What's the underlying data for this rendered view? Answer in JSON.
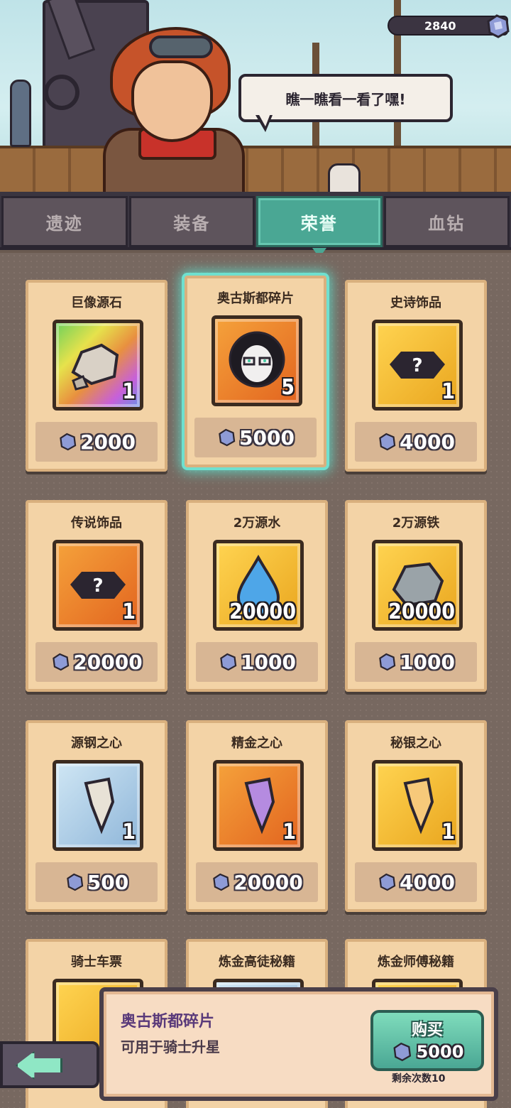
{
  "header": {
    "currency_value": "2840",
    "speech_text": "瞧一瞧看一看了嘿!"
  },
  "tabs": [
    {
      "label": "遗迹",
      "active": false
    },
    {
      "label": "装备",
      "active": false
    },
    {
      "label": "荣誉",
      "active": true
    },
    {
      "label": "血钻",
      "active": false
    }
  ],
  "items": [
    {
      "name": "巨像源石",
      "qty": "1",
      "price": "2000",
      "bg": "rainbow",
      "icon": "rock-icon"
    },
    {
      "name": "奥古斯都碎片",
      "qty": "5",
      "price": "5000",
      "bg": "orange",
      "icon": "hero-portrait-icon",
      "selected": true
    },
    {
      "name": "史诗饰品",
      "qty": "1",
      "price": "4000",
      "bg": "gold",
      "icon": "mystery-accessory-icon"
    },
    {
      "name": "传说饰品",
      "qty": "1",
      "price": "20000",
      "bg": "orange",
      "icon": "mystery-accessory-icon"
    },
    {
      "name": "2万源水",
      "qty": "20000",
      "price": "1000",
      "bg": "gold",
      "icon": "water-drop-icon"
    },
    {
      "name": "2万源铁",
      "qty": "20000",
      "price": "1000",
      "bg": "gold",
      "icon": "iron-ore-icon"
    },
    {
      "name": "源钢之心",
      "qty": "1",
      "price": "500",
      "bg": "blue",
      "icon": "crystal-fang-icon"
    },
    {
      "name": "精金之心",
      "qty": "1",
      "price": "20000",
      "bg": "orange",
      "icon": "crystal-fang-icon"
    },
    {
      "name": "秘银之心",
      "qty": "1",
      "price": "4000",
      "bg": "gold",
      "icon": "crystal-fang-icon"
    },
    {
      "name": "骑士车票",
      "bg": "gold",
      "icon": "ticket-icon"
    },
    {
      "name": "炼金高徒秘籍",
      "bg": "blue",
      "icon": "book-icon"
    },
    {
      "name": "炼金师傅秘籍",
      "bg": "gold",
      "icon": "book-icon"
    }
  ],
  "detail": {
    "title": "奥古斯都碎片",
    "description": "可用于骑士升星",
    "buy_label": "购买",
    "buy_cost": "5000",
    "remaining": "剩余次数10"
  },
  "colors": {
    "accent": "#4aa794",
    "card": "#f3d3a6",
    "selected_glow": "#6fe0cf"
  }
}
